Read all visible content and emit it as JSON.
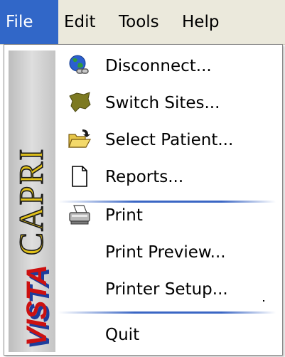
{
  "menubar": {
    "items": [
      "File",
      "Edit",
      "Tools",
      "Help"
    ],
    "active_index": 0
  },
  "file_menu": {
    "brand": {
      "vista_text": "VISTA",
      "capri_text": "CAPRI"
    },
    "items": [
      {
        "label": "Disconnect...",
        "icon": "globe-network-icon"
      },
      {
        "label": "Switch Sites...",
        "icon": "map-region-icon"
      },
      {
        "label": "Select Patient...",
        "icon": "open-folder-icon"
      },
      {
        "label": "Reports...",
        "icon": "blank-document-icon"
      },
      {
        "label": "Print",
        "icon": "printer-icon"
      },
      {
        "label": "Print Preview...",
        "icon": ""
      },
      {
        "label": "Printer Setup...",
        "icon": ""
      },
      {
        "label": "Quit",
        "icon": ""
      }
    ]
  },
  "colors": {
    "menubar_bg": "#ebe9dc",
    "highlight": "#3167c8",
    "separator": "#3a66c4",
    "vista_red": "#cc1111",
    "vista_blue": "#1d3d9c"
  }
}
